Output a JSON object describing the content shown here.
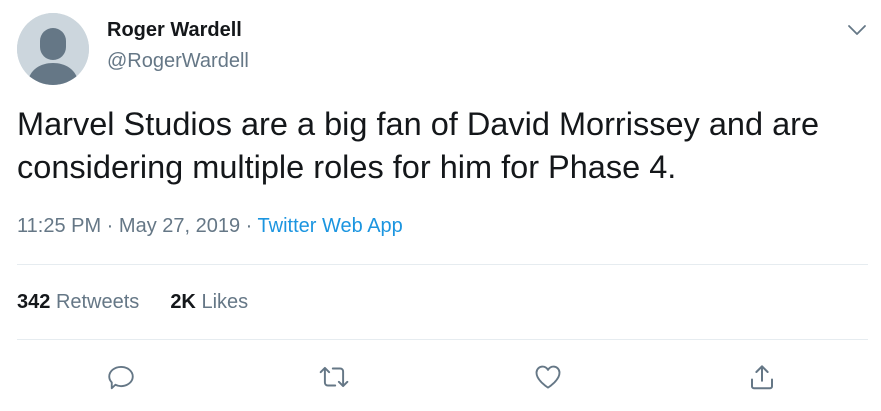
{
  "tweet": {
    "author_name": "Roger Wardell",
    "author_handle": "@RogerWardell",
    "text": "Marvel Studios are a big fan of David Morrissey and are considering multiple roles for him for Phase 4.",
    "time": "11:25 PM",
    "sep1": " · ",
    "date": "May 27, 2019",
    "sep2": " · ",
    "source": "Twitter Web App"
  },
  "stats": {
    "retweets_count": "342",
    "retweets_label": "Retweets",
    "likes_count": "2K",
    "likes_label": "Likes"
  },
  "icons": {
    "avatar": "default-avatar-icon",
    "menu": "chevron-down-icon",
    "reply": "reply-icon",
    "retweet": "retweet-icon",
    "like": "heart-icon",
    "share": "share-icon"
  },
  "colors": {
    "text": "#14171a",
    "muted": "#657786",
    "link": "#1b95e0",
    "divider": "#e6ecf0",
    "avatar_bg": "#ccd6dd"
  }
}
